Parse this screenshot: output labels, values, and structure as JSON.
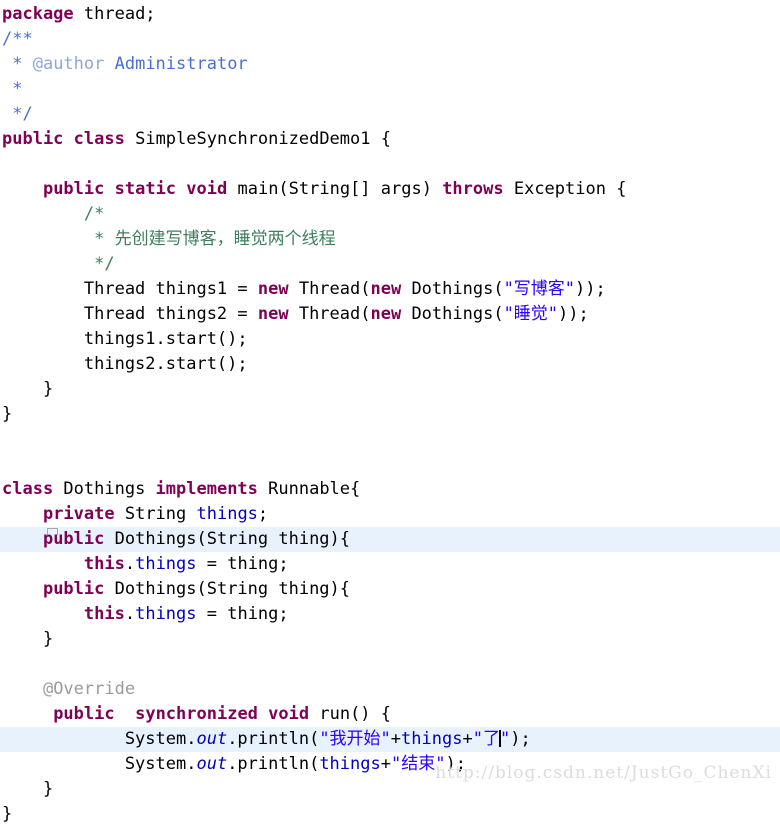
{
  "editor": {
    "language": "java",
    "background": "#ffffff",
    "highlight_color": "#e8f2fc",
    "colors": {
      "keyword": "#7f0055",
      "string": "#2a00ff",
      "comment": "#3f7f5f",
      "javadoc": "#4a6fd4",
      "javadoc_tag": "#8fa8d8",
      "field": "#0000c0",
      "static_field": "#0000c0",
      "annotation": "#9a9a9a",
      "plain": "#000000",
      "watermark": "#dcdcdc"
    }
  },
  "code": {
    "lines": [
      {
        "n": 1,
        "hl": false,
        "tokens": [
          {
            "t": "package",
            "c": "kw"
          },
          {
            "t": " thread;",
            "c": "plain"
          }
        ]
      },
      {
        "n": 2,
        "hl": false,
        "tokens": [
          {
            "t": "/**",
            "c": "jdoc"
          }
        ]
      },
      {
        "n": 3,
        "hl": false,
        "tokens": [
          {
            "t": " * ",
            "c": "jdoc"
          },
          {
            "t": "@author",
            "c": "jdoctag"
          },
          {
            "t": " Administrator",
            "c": "jdoc"
          }
        ]
      },
      {
        "n": 4,
        "hl": false,
        "tokens": [
          {
            "t": " *",
            "c": "jdoc"
          }
        ]
      },
      {
        "n": 5,
        "hl": false,
        "tokens": [
          {
            "t": " */",
            "c": "jdoc"
          }
        ]
      },
      {
        "n": 6,
        "hl": false,
        "tokens": [
          {
            "t": "public",
            "c": "kw"
          },
          {
            "t": " ",
            "c": "plain"
          },
          {
            "t": "class",
            "c": "kw"
          },
          {
            "t": " SimpleSynchronizedDemo1 {",
            "c": "plain"
          }
        ]
      },
      {
        "n": 7,
        "hl": false,
        "tokens": [
          {
            "t": "",
            "c": "plain"
          }
        ]
      },
      {
        "n": 8,
        "hl": false,
        "tokens": [
          {
            "t": "    ",
            "c": "plain"
          },
          {
            "t": "public",
            "c": "kw"
          },
          {
            "t": " ",
            "c": "plain"
          },
          {
            "t": "static",
            "c": "kw"
          },
          {
            "t": " ",
            "c": "plain"
          },
          {
            "t": "void",
            "c": "kw"
          },
          {
            "t": " main(String[] args) ",
            "c": "plain"
          },
          {
            "t": "throws",
            "c": "kw"
          },
          {
            "t": " Exception {",
            "c": "plain"
          }
        ]
      },
      {
        "n": 9,
        "hl": false,
        "tokens": [
          {
            "t": "        /*",
            "c": "cmt"
          }
        ]
      },
      {
        "n": 10,
        "hl": false,
        "tokens": [
          {
            "t": "         * 先创建写博客，睡觉两个线程",
            "c": "cmt"
          }
        ]
      },
      {
        "n": 11,
        "hl": false,
        "tokens": [
          {
            "t": "         */",
            "c": "cmt"
          }
        ]
      },
      {
        "n": 12,
        "hl": false,
        "tokens": [
          {
            "t": "        Thread things1 = ",
            "c": "plain"
          },
          {
            "t": "new",
            "c": "kw"
          },
          {
            "t": " Thread(",
            "c": "plain"
          },
          {
            "t": "new",
            "c": "kw"
          },
          {
            "t": " Dothings(",
            "c": "plain"
          },
          {
            "t": "\"写博客\"",
            "c": "str"
          },
          {
            "t": "));",
            "c": "plain"
          }
        ]
      },
      {
        "n": 13,
        "hl": false,
        "tokens": [
          {
            "t": "        Thread things2 = ",
            "c": "plain"
          },
          {
            "t": "new",
            "c": "kw"
          },
          {
            "t": " Thread(",
            "c": "plain"
          },
          {
            "t": "new",
            "c": "kw"
          },
          {
            "t": " Dothings(",
            "c": "plain"
          },
          {
            "t": "\"睡觉\"",
            "c": "str"
          },
          {
            "t": "));",
            "c": "plain"
          }
        ]
      },
      {
        "n": 14,
        "hl": false,
        "tokens": [
          {
            "t": "        things1.start();",
            "c": "plain"
          }
        ]
      },
      {
        "n": 15,
        "hl": false,
        "tokens": [
          {
            "t": "        things2.start();",
            "c": "plain"
          }
        ]
      },
      {
        "n": 16,
        "hl": false,
        "tokens": [
          {
            "t": "    }",
            "c": "plain"
          }
        ]
      },
      {
        "n": 17,
        "hl": false,
        "tokens": [
          {
            "t": "}",
            "c": "plain"
          }
        ]
      },
      {
        "n": 18,
        "hl": false,
        "tokens": [
          {
            "t": "",
            "c": "plain"
          }
        ]
      },
      {
        "n": 19,
        "hl": false,
        "tokens": [
          {
            "t": "",
            "c": "plain"
          }
        ]
      },
      {
        "n": 20,
        "hl": false,
        "tokens": [
          {
            "t": "class",
            "c": "kw"
          },
          {
            "t": " Dothings ",
            "c": "plain"
          },
          {
            "t": "implements",
            "c": "kw"
          },
          {
            "t": " Runnable{",
            "c": "plain"
          }
        ]
      },
      {
        "n": 21,
        "hl": false,
        "tokens": [
          {
            "t": "    ",
            "c": "plain"
          },
          {
            "t": "private",
            "c": "kw"
          },
          {
            "t": " String ",
            "c": "plain"
          },
          {
            "t": "things",
            "c": "fld"
          },
          {
            "t": ";",
            "c": "plain"
          }
        ]
      },
      {
        "n": 22,
        "hl": true,
        "tokens": [
          {
            "t": "    ",
            "c": "plain"
          },
          {
            "t": "public",
            "c": "kw"
          },
          {
            "t": " Dothings(String thing){",
            "c": "plain"
          }
        ]
      },
      {
        "n": 23,
        "hl": false,
        "tokens": [
          {
            "t": "        ",
            "c": "plain"
          },
          {
            "t": "this",
            "c": "kw"
          },
          {
            "t": ".",
            "c": "plain"
          },
          {
            "t": "things",
            "c": "fld"
          },
          {
            "t": " = thing;",
            "c": "plain"
          }
        ]
      },
      {
        "n": 24,
        "hl": false,
        "tokens": [
          {
            "t": "    ",
            "c": "plain"
          },
          {
            "t": "public",
            "c": "kw"
          },
          {
            "t": " Dothings(String thing){",
            "c": "plain"
          }
        ]
      },
      {
        "n": 25,
        "hl": false,
        "tokens": [
          {
            "t": "        ",
            "c": "plain"
          },
          {
            "t": "this",
            "c": "kw"
          },
          {
            "t": ".",
            "c": "plain"
          },
          {
            "t": "things",
            "c": "fld"
          },
          {
            "t": " = thing;",
            "c": "plain"
          }
        ]
      },
      {
        "n": 26,
        "hl": false,
        "tokens": [
          {
            "t": "    }",
            "c": "plain"
          }
        ]
      },
      {
        "n": 27,
        "hl": false,
        "tokens": [
          {
            "t": "",
            "c": "plain"
          }
        ]
      },
      {
        "n": 28,
        "hl": false,
        "tokens": [
          {
            "t": "    ",
            "c": "plain"
          },
          {
            "t": "@Override",
            "c": "ann"
          }
        ]
      },
      {
        "n": 29,
        "hl": false,
        "tokens": [
          {
            "t": "     ",
            "c": "plain"
          },
          {
            "t": "public",
            "c": "kw"
          },
          {
            "t": "  ",
            "c": "plain"
          },
          {
            "t": "synchronized",
            "c": "kw"
          },
          {
            "t": " ",
            "c": "plain"
          },
          {
            "t": "void",
            "c": "kw"
          },
          {
            "t": " run() {",
            "c": "plain"
          }
        ]
      },
      {
        "n": 30,
        "hl": true,
        "caret_after": "了",
        "tokens": [
          {
            "t": "            System.",
            "c": "plain"
          },
          {
            "t": "out",
            "c": "stat"
          },
          {
            "t": ".println(",
            "c": "plain"
          },
          {
            "t": "\"我开始\"",
            "c": "str"
          },
          {
            "t": "+",
            "c": "plain"
          },
          {
            "t": "things",
            "c": "fld"
          },
          {
            "t": "+",
            "c": "plain"
          },
          {
            "t": "\"了",
            "c": "str"
          },
          {
            "t": "CARET",
            "c": "caret"
          },
          {
            "t": "\"",
            "c": "str"
          },
          {
            "t": ");",
            "c": "plain"
          }
        ]
      },
      {
        "n": 31,
        "hl": false,
        "tokens": [
          {
            "t": "            System.",
            "c": "plain"
          },
          {
            "t": "out",
            "c": "stat"
          },
          {
            "t": ".println(",
            "c": "plain"
          },
          {
            "t": "things",
            "c": "fld"
          },
          {
            "t": "+",
            "c": "plain"
          },
          {
            "t": "\"结束\"",
            "c": "str"
          },
          {
            "t": ");",
            "c": "plain"
          }
        ]
      },
      {
        "n": 32,
        "hl": false,
        "tokens": [
          {
            "t": "    }",
            "c": "plain"
          }
        ]
      },
      {
        "n": 33,
        "hl": false,
        "tokens": [
          {
            "t": "}",
            "c": "plain"
          }
        ]
      }
    ]
  },
  "watermark": {
    "text": "http://blog.csdn.net/JustGo_ChenXi"
  }
}
